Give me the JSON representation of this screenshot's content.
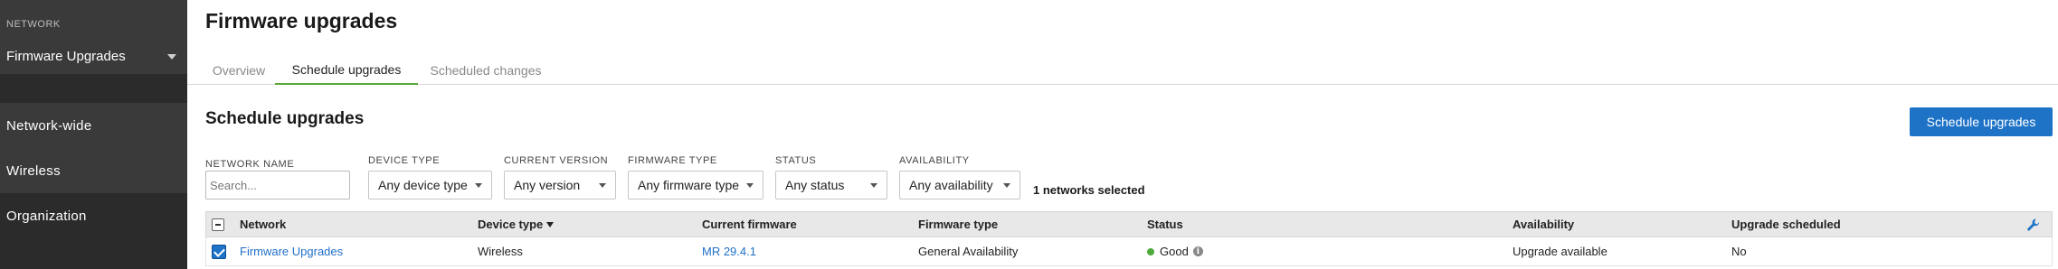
{
  "sidebar": {
    "network_label": "NETWORK",
    "network_selected": "Firmware Upgrades",
    "items": [
      {
        "label": "Network-wide"
      },
      {
        "label": "Wireless"
      },
      {
        "label": "Organization"
      }
    ]
  },
  "page": {
    "title": "Firmware upgrades",
    "tabs": [
      {
        "label": "Overview",
        "active": false
      },
      {
        "label": "Schedule upgrades",
        "active": true
      },
      {
        "label": "Scheduled changes",
        "active": false
      }
    ]
  },
  "section": {
    "title": "Schedule upgrades",
    "action_button": "Schedule upgrades"
  },
  "filters": {
    "network_name": {
      "label": "NETWORK NAME",
      "placeholder": "Search..."
    },
    "device_type": {
      "label": "DEVICE TYPE",
      "value": "Any device type"
    },
    "current_version": {
      "label": "CURRENT VERSION",
      "value": "Any version"
    },
    "firmware_type": {
      "label": "FIRMWARE TYPE",
      "value": "Any firmware type"
    },
    "status": {
      "label": "STATUS",
      "value": "Any status"
    },
    "availability": {
      "label": "AVAILABILITY",
      "value": "Any availability"
    },
    "selected_count": "1 networks selected"
  },
  "table": {
    "columns": [
      "Network",
      "Device type",
      "Current firmware",
      "Firmware type",
      "Status",
      "Availability",
      "Upgrade scheduled"
    ],
    "sorted_column": "Device type",
    "rows": [
      {
        "checked": true,
        "network": "Firmware Upgrades",
        "device_type": "Wireless",
        "current_firmware": "MR 29.4.1",
        "firmware_type": "General Availability",
        "status": "Good",
        "availability": "Upgrade available",
        "upgrade_scheduled": "No"
      }
    ]
  },
  "colors": {
    "accent": "#1e73c7",
    "sidebar_bg": "#3a3a3a",
    "active_tab_underline": "#5da83a",
    "status_good": "#4caa3b"
  }
}
